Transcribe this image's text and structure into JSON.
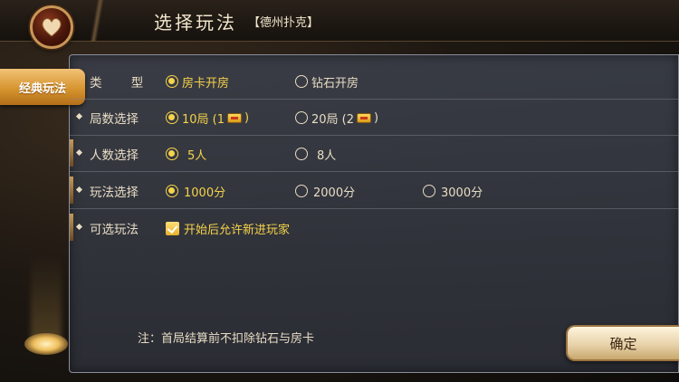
{
  "header": {
    "title": "选择玩法",
    "subtitle": "【德州扑克】"
  },
  "sidebar": {
    "tab_label": "经典玩法"
  },
  "rows": {
    "type": {
      "label": "类 型",
      "options": [
        {
          "label": "房卡开房",
          "selected": true
        },
        {
          "label": "钻石开房",
          "selected": false
        }
      ]
    },
    "rounds": {
      "label": "局数选择",
      "options": [
        {
          "prefix": "10局 (1",
          "suffix": ")",
          "selected": true
        },
        {
          "prefix": "20局 (2",
          "suffix": ")",
          "selected": false
        }
      ]
    },
    "players": {
      "label": "人数选择",
      "options": [
        {
          "label": "5人",
          "selected": true
        },
        {
          "label": "8人",
          "selected": false
        }
      ]
    },
    "score": {
      "label": "玩法选择",
      "options": [
        {
          "label": "1000分",
          "selected": true
        },
        {
          "label": "2000分",
          "selected": false
        },
        {
          "label": "3000分",
          "selected": false
        }
      ]
    },
    "optional": {
      "label": "可选玩法",
      "checkbox_label": "开始后允许新进玩家",
      "checked": true
    }
  },
  "note": "注：首局结算前不扣除钻石与房卡",
  "confirm_label": "确定",
  "colors": {
    "accent_yellow": "#f5d34a",
    "tab_orange": "#d6952f",
    "panel_bg": "#3a3e48"
  }
}
